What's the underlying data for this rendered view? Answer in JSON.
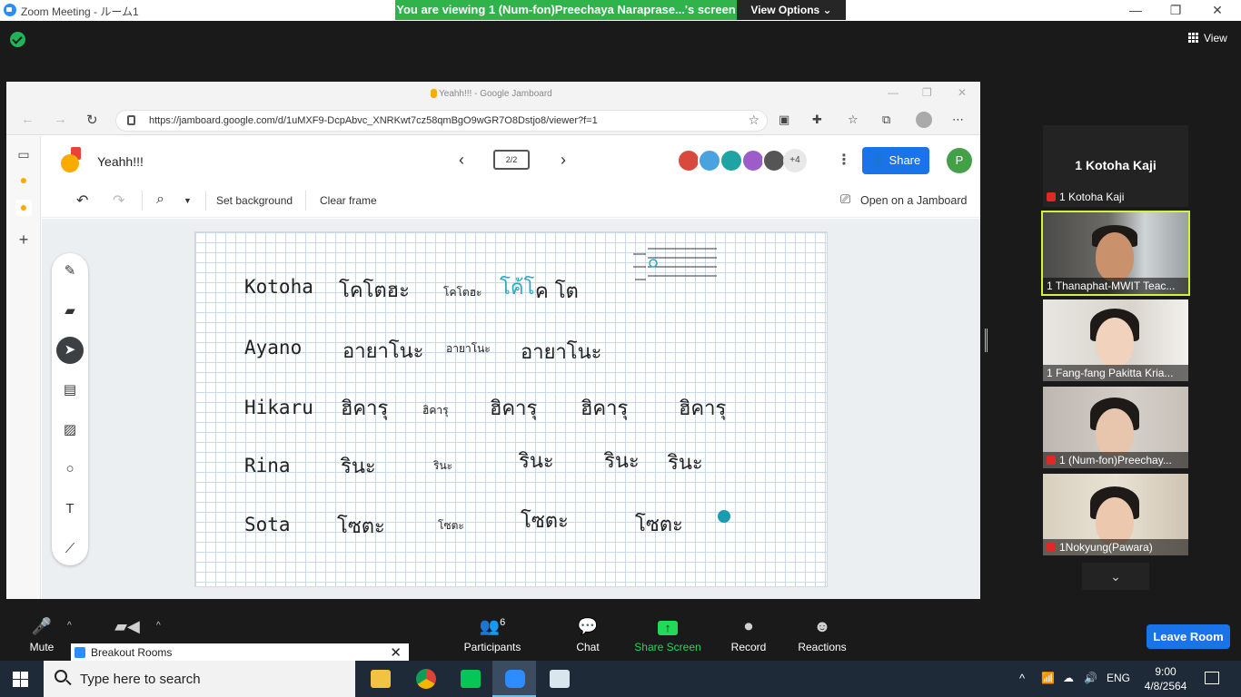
{
  "zoom": {
    "window_title": "Zoom Meeting - ルーム1",
    "viewing_banner": "You are viewing 1 (Num-fon)Preechaya Naraprase...'s screen",
    "view_options": "View Options ⌄",
    "view_label": "View",
    "active_speaker": "1 Kotoha  Kaji",
    "active_speaker_tag": "1 Kotoha  Kaji",
    "participants": [
      {
        "name": "1 Thanaphat-MWIT Teac...",
        "muted": false,
        "active": true
      },
      {
        "name": "1 Fang-fang Pakitta Kria...",
        "muted": false,
        "active": false
      },
      {
        "name": "1 (Num-fon)Preechay...",
        "muted": true,
        "active": false
      },
      {
        "name": "1Nokyung(Pawara)",
        "muted": true,
        "active": false
      }
    ],
    "bottom_bar": {
      "mute": "Mute",
      "participants": "Participants",
      "participants_count": "6",
      "chat": "Chat",
      "share_screen": "Share Screen",
      "record": "Record",
      "reactions": "Reactions",
      "leave": "Leave Room"
    },
    "breakout_popup": "Breakout Rooms",
    "colors": {
      "banner": "#2fb34a",
      "leave": "#1a73e8",
      "share": "#23d959",
      "active_tile": "#d4f23a"
    }
  },
  "browser": {
    "window_title": "Yeahh!!! - Google Jamboard",
    "url": "https://jamboard.google.com/d/1uMXF9-DcpAbvc_XNRKwt7cz58qmBgO9wGR7O8Dstjo8/viewer?f=1"
  },
  "jamboard": {
    "title": "Yeahh!!!",
    "frame_counter": "2/2",
    "more_collaborators": "+4",
    "share": "Share",
    "user_initial": "P",
    "toolbar": {
      "set_background": "Set background",
      "clear_frame": "Clear frame",
      "open_on_jamboard": "Open on a Jamboard"
    },
    "rows": [
      {
        "roman": "Kotoha",
        "thai": "โคโตฮะ",
        "typed": "โคโตฮะ",
        "extra": [
          "โค้โ"
        ]
      },
      {
        "roman": "Ayano",
        "thai": "อายาโนะ",
        "typed": "อายาโนะ",
        "extra": [
          "อายาโนะ"
        ]
      },
      {
        "roman": "Hikaru",
        "thai": "ฮิคารุ",
        "typed": "ฮิคารุ",
        "extra": [
          "ฮิคารุ",
          "ฮิคารุ",
          "ฮิคารุ"
        ]
      },
      {
        "roman": "Rina",
        "thai": "รินะ",
        "typed": "รินะ",
        "extra": [
          "รินะ",
          "รินะ",
          "รินะ"
        ]
      },
      {
        "roman": "Sota",
        "thai": "โซตะ",
        "typed": "โซตะ",
        "extra": [
          "โซตะ",
          "โซตะ"
        ]
      }
    ]
  },
  "taskbar": {
    "search_placeholder": "Type here to search",
    "language": "ENG",
    "time": "9:00",
    "date": "4/8/2564"
  }
}
